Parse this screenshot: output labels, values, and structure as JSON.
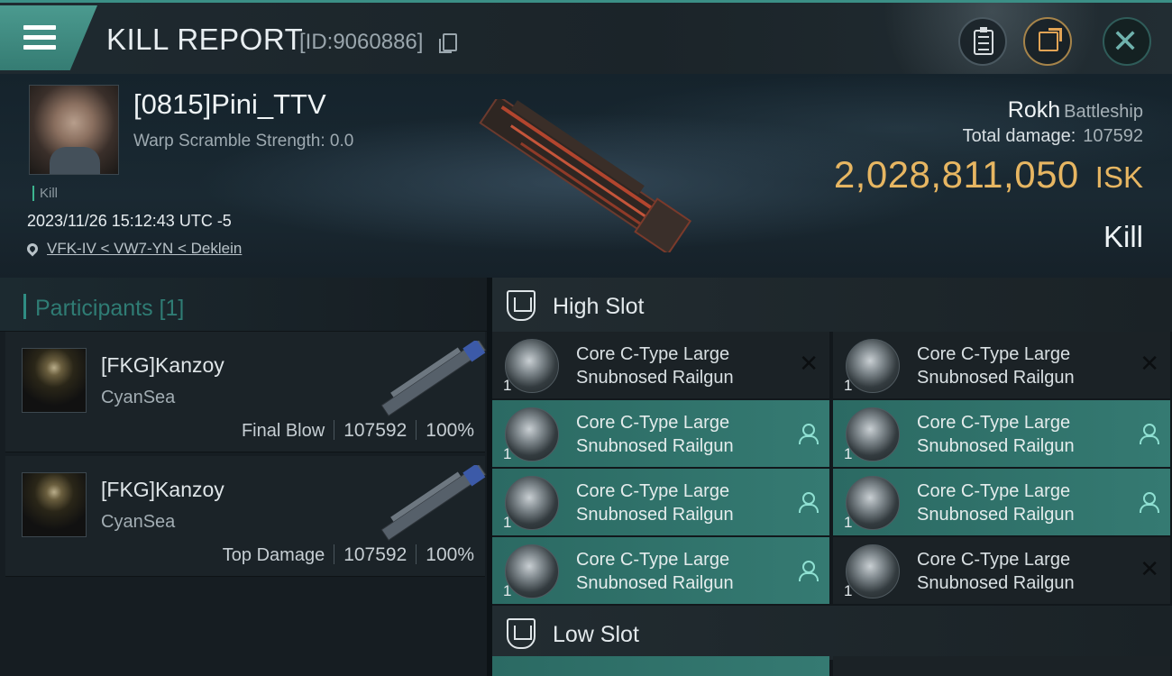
{
  "header": {
    "title": "KILL REPORT",
    "report_id": "[ID:9060886]",
    "icons": [
      "menu-icon",
      "copy-icon",
      "clipboard-icon",
      "share-icon",
      "close-icon"
    ]
  },
  "victim": {
    "name": "[0815]Pini_TTV",
    "warp_scramble": "Warp Scramble Strength: 0.0",
    "tag": "Kill",
    "timestamp": "2023/11/26 15:12:43 UTC -5",
    "location": "VFK-IV < VW7-YN < Deklein",
    "ship_name": "Rokh",
    "ship_class": "Battleship",
    "total_damage_label": "Total damage:",
    "total_damage_value": "107592",
    "isk_value": "2,028,811,050",
    "isk_unit": "ISK",
    "result": "Kill"
  },
  "participants": {
    "title": "Participants [1]",
    "rows": [
      {
        "name": "[FKG]Kanzoy",
        "corp": "CyanSea",
        "label": "Final Blow",
        "damage": "107592",
        "percent": "100%"
      },
      {
        "name": "[FKG]Kanzoy",
        "corp": "CyanSea",
        "label": "Top Damage",
        "damage": "107592",
        "percent": "100%"
      }
    ]
  },
  "fitting": {
    "high_slot_title": "High Slot",
    "low_slot_title": "Low Slot",
    "module_line1": "Core C-Type Large",
    "module_line2": "Snubnosed Railgun",
    "qty": "1",
    "modules": [
      {
        "status": "destroyed"
      },
      {
        "status": "destroyed"
      },
      {
        "status": "dropped"
      },
      {
        "status": "dropped"
      },
      {
        "status": "dropped"
      },
      {
        "status": "dropped"
      },
      {
        "status": "dropped"
      },
      {
        "status": "destroyed"
      }
    ]
  },
  "colors": {
    "accent": "#3b8f86",
    "isk": "#e7b662",
    "dropped_row": "#357a72"
  }
}
